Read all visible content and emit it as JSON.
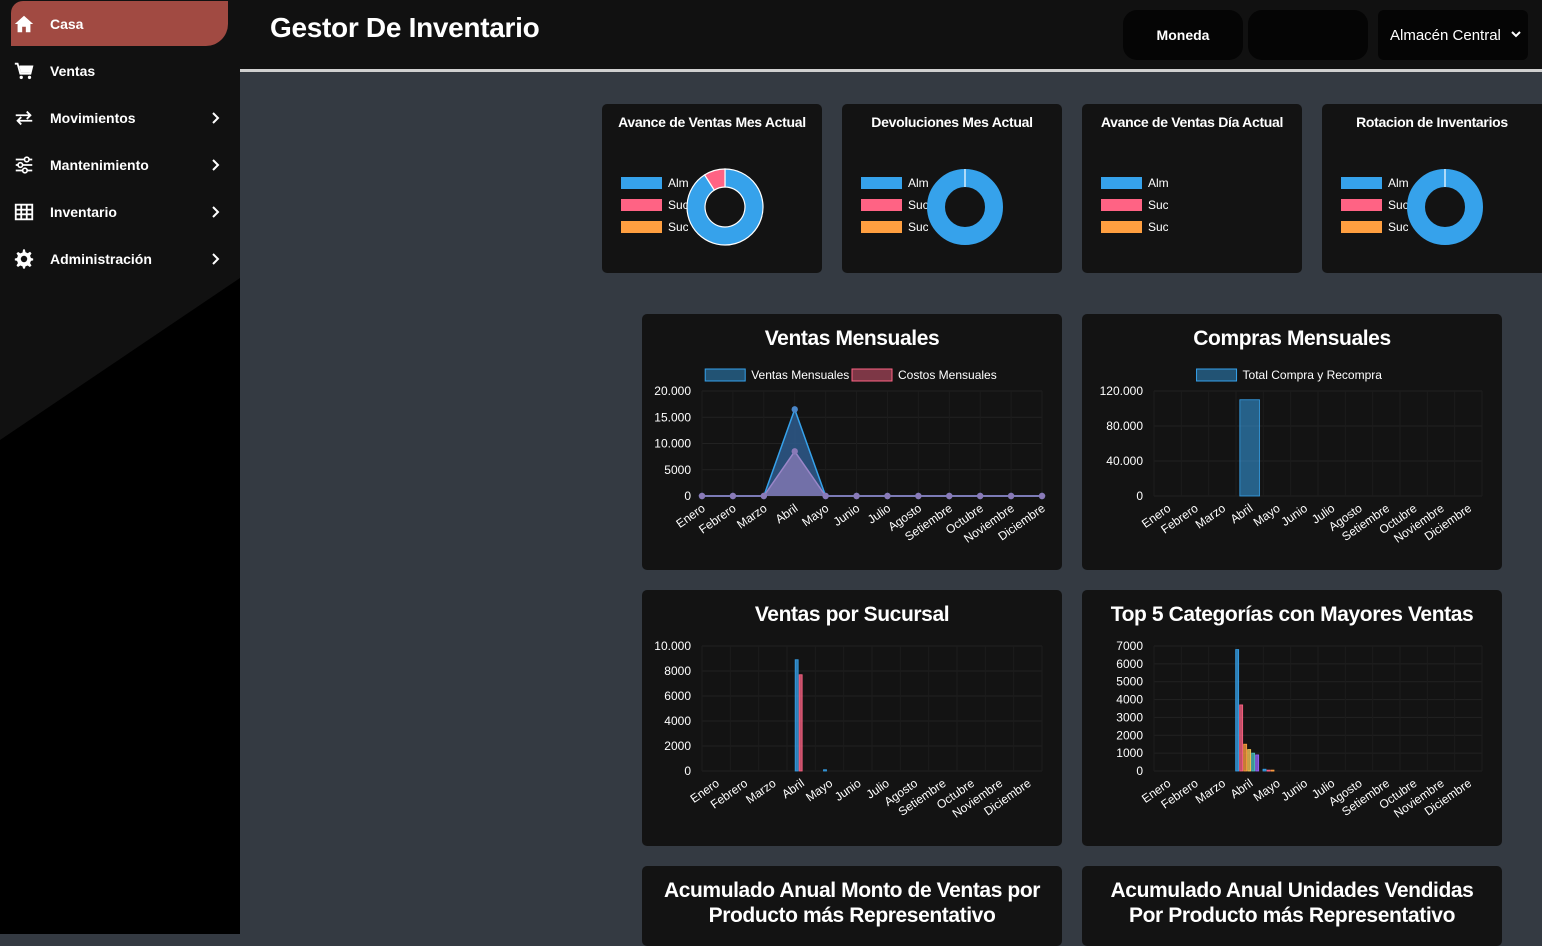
{
  "app": {
    "title": "Gestor De Inventario"
  },
  "sidebar": {
    "items": [
      {
        "label": "Casa",
        "icon": "home-icon",
        "active": true,
        "has_submenu": false
      },
      {
        "label": "Ventas",
        "icon": "cart-icon",
        "active": false,
        "has_submenu": false
      },
      {
        "label": "Movimientos",
        "icon": "swap-icon",
        "active": false,
        "has_submenu": true
      },
      {
        "label": "Mantenimiento",
        "icon": "sliders-icon",
        "active": false,
        "has_submenu": true
      },
      {
        "label": "Inventario",
        "icon": "grid-icon",
        "active": false,
        "has_submenu": true
      },
      {
        "label": "Administración",
        "icon": "gear-icon",
        "active": false,
        "has_submenu": true
      }
    ]
  },
  "header": {
    "currency_button": "Moneda",
    "blank_button": "",
    "warehouse_selected": "Almacén Central"
  },
  "colors": {
    "blue": "#36a2eb",
    "pink": "#ff6384",
    "orange": "#ff9f40",
    "active_nav": "#a14a42",
    "content_bg": "#343a42",
    "card_bg": "#131313"
  },
  "kpi_cards": [
    {
      "title": "Avance de Ventas Mes Actual",
      "legend": [
        "Alm",
        "Suc",
        "Suc"
      ],
      "slices": [
        0.91,
        0.09,
        0
      ]
    },
    {
      "title": "Devoluciones Mes Actual",
      "legend": [
        "Alm",
        "Suc",
        "Suc"
      ],
      "slices": [
        1,
        0,
        0
      ]
    },
    {
      "title": "Avance de Ventas Día Actual",
      "legend": [
        "Alm",
        "Suc",
        "Suc"
      ],
      "slices": []
    },
    {
      "title": "Rotacion de Inventarios",
      "legend": [
        "Alm",
        "Suc",
        "Suc"
      ],
      "slices": [
        1,
        0,
        0
      ]
    }
  ],
  "chart_data": [
    {
      "type": "area",
      "title": "Ventas Mensuales",
      "categories": [
        "Enero",
        "Febrero",
        "Marzo",
        "Abril",
        "Mayo",
        "Junio",
        "Julio",
        "Agosto",
        "Setiembre",
        "Octubre",
        "Noviembre",
        "Diciembre"
      ],
      "series": [
        {
          "name": "Ventas Mensuales",
          "values": [
            0,
            0,
            0,
            16500,
            0,
            0,
            0,
            0,
            0,
            0,
            0,
            0
          ]
        },
        {
          "name": "Costos Mensuales",
          "values": [
            0,
            0,
            0,
            8500,
            0,
            0,
            0,
            0,
            0,
            0,
            0,
            0
          ]
        }
      ],
      "yticks": [
        "20.000",
        "15.000",
        "10.000",
        "5000",
        "0"
      ],
      "ylim": [
        0,
        20000
      ],
      "legend_position": "top"
    },
    {
      "type": "bar",
      "title": "Compras Mensuales",
      "categories": [
        "Enero",
        "Febrero",
        "Marzo",
        "Abril",
        "Mayo",
        "Junio",
        "Julio",
        "Agosto",
        "Setiembre",
        "Octubre",
        "Noviembre",
        "Diciembre"
      ],
      "series": [
        {
          "name": "Total Compra y Recompra",
          "values": [
            0,
            0,
            0,
            110000,
            0,
            0,
            0,
            0,
            0,
            0,
            0,
            0
          ]
        }
      ],
      "yticks": [
        "120.000",
        "80.000",
        "40.000",
        "0"
      ],
      "ylim": [
        0,
        120000
      ],
      "legend_position": "top"
    },
    {
      "type": "bar",
      "title": "Ventas por Sucursal",
      "categories": [
        "Enero",
        "Febrero",
        "Marzo",
        "Abril",
        "Mayo",
        "Junio",
        "Julio",
        "Agosto",
        "Setiembre",
        "Octubre",
        "Noviembre",
        "Diciembre"
      ],
      "series": [
        {
          "values": [
            0,
            0,
            0,
            8900,
            100,
            0,
            0,
            0,
            0,
            0,
            0,
            0
          ]
        },
        {
          "values": [
            0,
            0,
            0,
            7700,
            0,
            0,
            0,
            0,
            0,
            0,
            0,
            0
          ]
        }
      ],
      "yticks": [
        "10.000",
        "8000",
        "6000",
        "4000",
        "2000",
        "0"
      ],
      "ylim": [
        0,
        10000
      ]
    },
    {
      "type": "bar",
      "title": "Top 5 Categorías con Mayores Ventas",
      "categories": [
        "Enero",
        "Febrero",
        "Marzo",
        "Abril",
        "Mayo",
        "Junio",
        "Julio",
        "Agosto",
        "Setiembre",
        "Octubre",
        "Noviembre",
        "Diciembre"
      ],
      "series": [
        {
          "values": [
            0,
            0,
            0,
            6800,
            100,
            0,
            0,
            0,
            0,
            0,
            0,
            0
          ]
        },
        {
          "values": [
            0,
            0,
            0,
            3700,
            50,
            0,
            0,
            0,
            0,
            0,
            0,
            0
          ]
        },
        {
          "values": [
            0,
            0,
            0,
            1500,
            50,
            0,
            0,
            0,
            0,
            0,
            0,
            0
          ]
        },
        {
          "values": [
            0,
            0,
            0,
            1200,
            0,
            0,
            0,
            0,
            0,
            0,
            0,
            0
          ]
        },
        {
          "values": [
            0,
            0,
            0,
            1000,
            0,
            0,
            0,
            0,
            0,
            0,
            0,
            0
          ]
        },
        {
          "values": [
            0,
            0,
            0,
            900,
            0,
            0,
            0,
            0,
            0,
            0,
            0,
            0
          ]
        }
      ],
      "yticks": [
        "7000",
        "6000",
        "5000",
        "4000",
        "3000",
        "2000",
        "1000",
        "0"
      ],
      "ylim": [
        0,
        7000
      ]
    }
  ],
  "bottom_cards": [
    {
      "title": "Acumulado Anual Monto de Ventas por Producto más Representativo"
    },
    {
      "title": "Acumulado Anual Unidades Vendidas Por Producto más Representativo"
    }
  ]
}
